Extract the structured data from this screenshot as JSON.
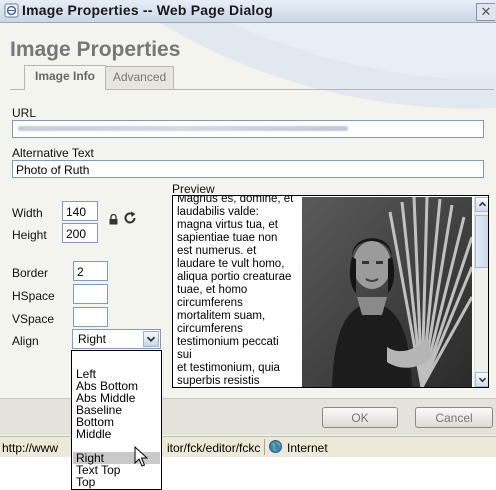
{
  "window": {
    "title": "Image Properties -- Web Page Dialog",
    "close_glyph": "✕"
  },
  "dialog": {
    "heading": "Image Properties"
  },
  "tabs": [
    {
      "label": "Image Info",
      "active": true
    },
    {
      "label": "Advanced",
      "active": false
    }
  ],
  "url": {
    "label": "URL"
  },
  "alt": {
    "label": "Alternative Text",
    "value": "Photo of Ruth"
  },
  "size": {
    "width_label": "Width",
    "width_value": "140",
    "height_label": "Height",
    "height_value": "200"
  },
  "spacing": {
    "border_label": "Border",
    "border_value": "2",
    "hspace_label": "HSpace",
    "hspace_value": "",
    "vspace_label": "VSpace",
    "vspace_value": ""
  },
  "align": {
    "label": "Align",
    "selected": "Right",
    "options": [
      "Left",
      "Abs Bottom",
      "Abs Middle",
      "Baseline",
      "Bottom",
      "Middle",
      "Right",
      "Text Top",
      "Top"
    ]
  },
  "preview": {
    "label": "Preview",
    "text": "Magnus es, domine, et\nlaudabilis valde:\nmagna virtus tua, et\nsapientiae tuae non\nest numerus. et\nlaudare te vult homo,\naliqua portio creaturae\ntuae, et homo\ncircumferens\nmortalitem suam,\ncircumferens\ntestimonium peccati sui\net testimonium, quia\nsuperbis resistis"
  },
  "buttons": {
    "ok": "OK",
    "cancel": "Cancel"
  },
  "status": {
    "url_left": "http://www",
    "url_right": "itor/fck/editor/fckc",
    "zone": "Internet"
  },
  "icons": [
    "page-icon",
    "close-icon",
    "lock-icon",
    "reset-size-icon",
    "dropdown-arrow-icon",
    "scroll-up-icon",
    "scroll-down-icon",
    "globe-icon",
    "mouse-cursor-icon"
  ]
}
